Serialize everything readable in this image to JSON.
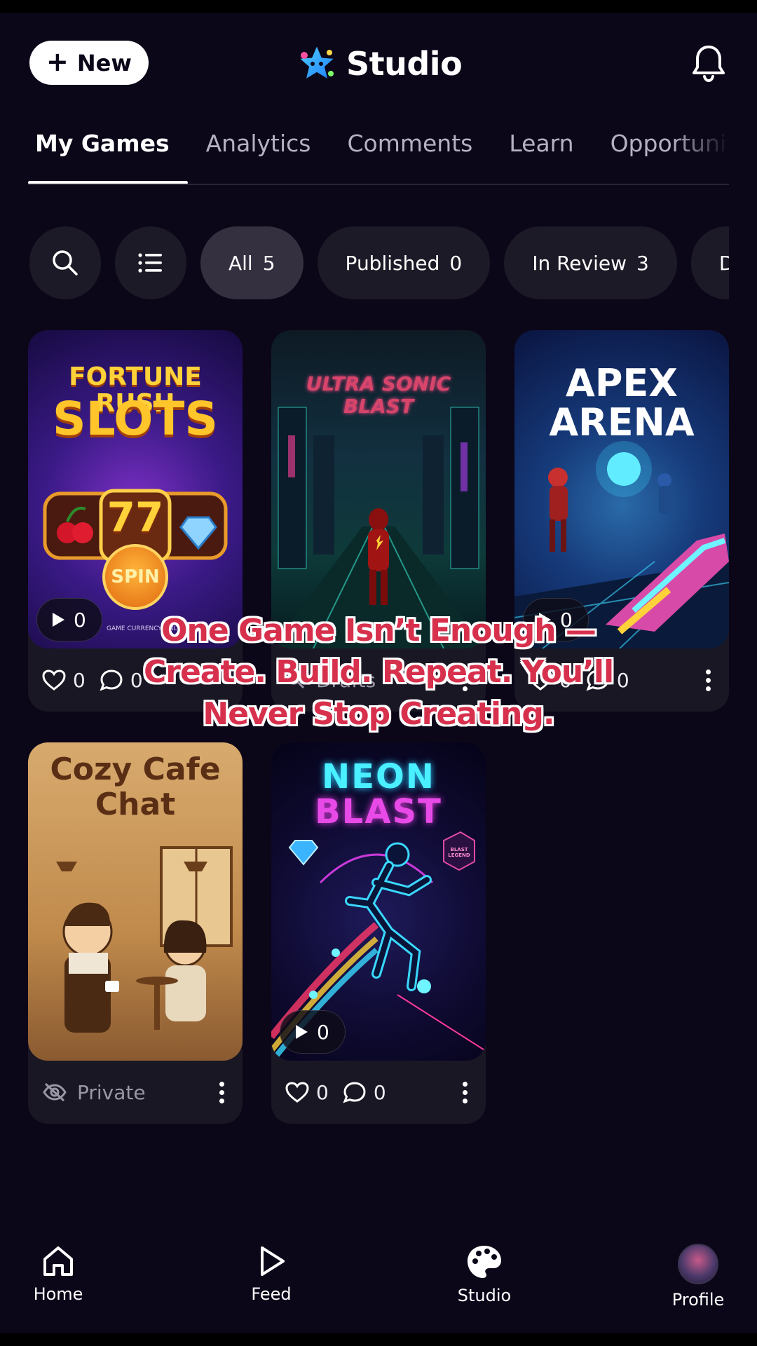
{
  "header": {
    "new_label": "New",
    "brand_title": "Studio"
  },
  "tabs": [
    {
      "label": "My Games",
      "active": true
    },
    {
      "label": "Analytics",
      "active": false
    },
    {
      "label": "Comments",
      "active": false
    },
    {
      "label": "Learn",
      "active": false
    },
    {
      "label": "Opportunit",
      "active": false
    }
  ],
  "filters": {
    "icons": [
      "search-icon",
      "list-icon"
    ],
    "chips": [
      {
        "label": "All",
        "count": "5",
        "active": true
      },
      {
        "label": "Published",
        "count": "0",
        "active": false
      },
      {
        "label": "In Review",
        "count": "3",
        "active": false
      },
      {
        "label": "D",
        "count": "",
        "active": false
      }
    ]
  },
  "games": [
    {
      "title_line1": "FORTUNE RUSH",
      "title_line2": "SLOTS",
      "plays": "0",
      "likes": "0",
      "comments": "0",
      "small_text": "GAME CURRENCY ONLY",
      "badge": "SPIN",
      "reel": "77"
    },
    {
      "title_line1": "ULTRA SONIC",
      "title_line2": "BLAST",
      "status": "Drafts",
      "private_label": ""
    },
    {
      "title_line1": "APEX",
      "title_line2": "ARENA",
      "plays": "0",
      "likes": "0",
      "comments": "0"
    },
    {
      "title_line1": "Cozy Cafe",
      "title_line2": "Chat",
      "private_label": "Private"
    },
    {
      "title_line1": "NEON",
      "title_line2": "BLAST",
      "plays": "0",
      "likes": "0",
      "comments": "0",
      "badge": "BLAST LEGEND"
    }
  ],
  "overlay": {
    "line1": "One Game Isn’t Enough —",
    "line2": "Create. Build. Repeat. You’ll",
    "line3": "Never Stop Creating."
  },
  "nav": [
    {
      "label": "Home",
      "icon": "home-icon"
    },
    {
      "label": "Feed",
      "icon": "play-icon"
    },
    {
      "label": "Studio",
      "icon": "palette-icon"
    },
    {
      "label": "Profile",
      "icon": "avatar"
    }
  ],
  "colors": {
    "background": "#0b0618",
    "chip": "#1d1a27",
    "chip_active": "#35303f",
    "overlay_text": "#d7304d"
  }
}
